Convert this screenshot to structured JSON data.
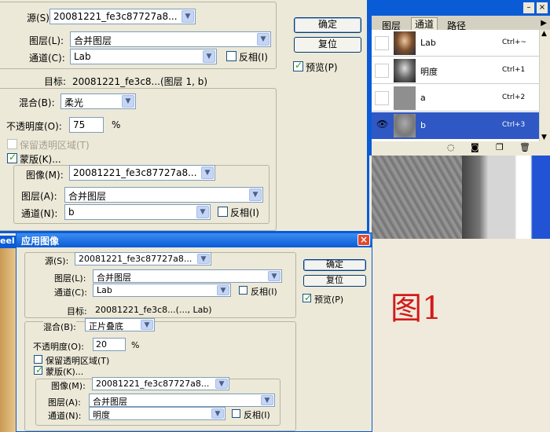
{
  "dialog_top": {
    "source_label": "源(S):",
    "source_value": "20081221_fe3c87727a8...",
    "layer_label": "图层(L):",
    "layer_value": "合并图层",
    "channel_label": "通道(C):",
    "channel_value": "Lab",
    "invert_label": "反相(I)",
    "target_label": "目标:",
    "target_value": "20081221_fe3c8...(图层 1, b)",
    "blend_label": "混合(B):",
    "blend_value": "柔光",
    "opacity_label": "不透明度(O):",
    "opacity_value": "75",
    "opacity_unit": "%",
    "preserve_label": "保留透明区域(T)",
    "mask_label": "蒙版(K)...",
    "mask_image_label": "图像(M):",
    "mask_image_value": "20081221_fe3c87727a8...",
    "mask_layer_label": "图层(A):",
    "mask_layer_value": "合并图层",
    "mask_channel_label": "通道(N):",
    "mask_channel_value": "b",
    "mask_invert_label": "反相(I)",
    "ok_label": "确定",
    "reset_label": "复位",
    "preview_label": "预览(P)"
  },
  "channels_panel": {
    "tabs": [
      "图层",
      "通道",
      "路径"
    ],
    "active_tab": "通道",
    "rows": [
      {
        "name": "Lab",
        "shortcut": "Ctrl+~",
        "visible": false,
        "selected": false
      },
      {
        "name": "明度",
        "shortcut": "Ctrl+1",
        "visible": false,
        "selected": false
      },
      {
        "name": "a",
        "shortcut": "Ctrl+2",
        "visible": false,
        "selected": false
      },
      {
        "name": "b",
        "shortcut": "Ctrl+3",
        "visible": true,
        "selected": true
      }
    ]
  },
  "dialog_bottom": {
    "title": "应用图像",
    "edge_text": "eel",
    "source_label": "源(S):",
    "source_value": "20081221_fe3c87727a8...",
    "layer_label": "图层(L):",
    "layer_value": "合并图层",
    "channel_label": "通道(C):",
    "channel_value": "Lab",
    "invert_label": "反相(I)",
    "target_label": "目标:",
    "target_value": "20081221_fe3c8...(..., Lab)",
    "blend_label": "混合(B):",
    "blend_value": "正片叠底",
    "opacity_label": "不透明度(O):",
    "opacity_value": "20",
    "opacity_unit": "%",
    "preserve_label": "保留透明区域(T)",
    "mask_label": "蒙版(K)...",
    "mask_image_label": "图像(M):",
    "mask_image_value": "20081221_fe3c87727a8...",
    "mask_layer_label": "图层(A):",
    "mask_layer_value": "合并图层",
    "mask_channel_label": "通道(N):",
    "mask_channel_value": "明度",
    "mask_invert_label": "反相(I)",
    "ok_label": "确定",
    "reset_label": "复位",
    "preview_label": "预览(P)"
  },
  "annotation": {
    "text": "图1",
    "color": "#d21a1a"
  }
}
